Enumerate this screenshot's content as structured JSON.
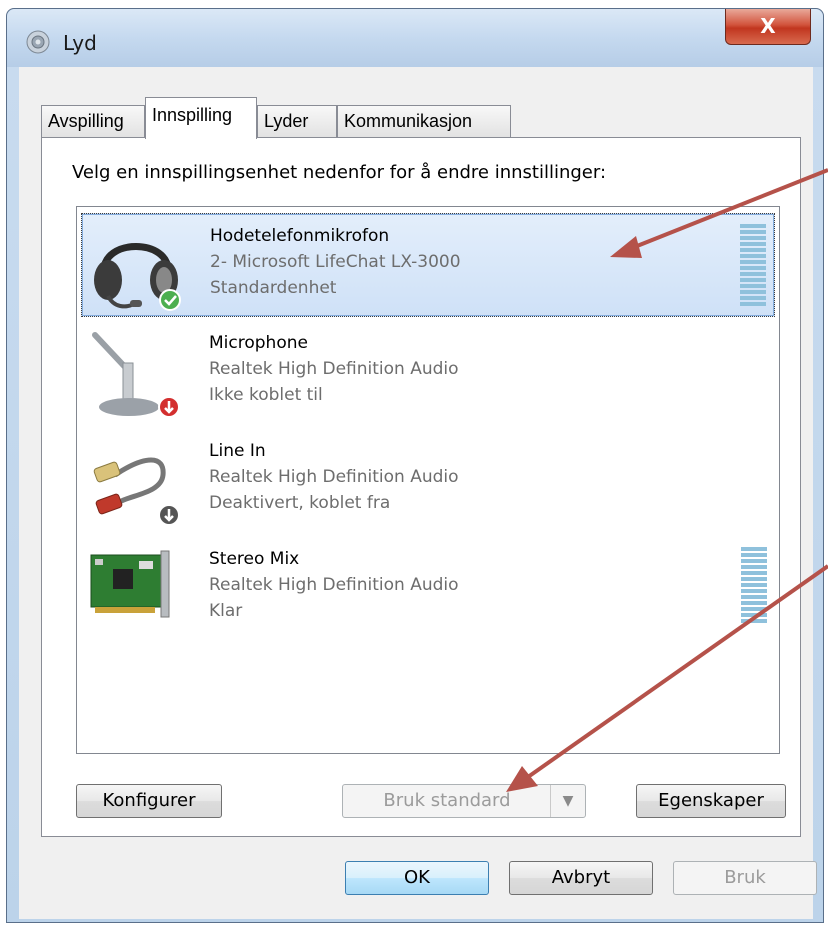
{
  "window": {
    "title": "Lyd",
    "close_label": "X"
  },
  "tabs": [
    {
      "label": "Avspilling",
      "active": false
    },
    {
      "label": "Innspilling",
      "active": true
    },
    {
      "label": "Lyder",
      "active": false
    },
    {
      "label": "Kommunikasjon",
      "active": false
    }
  ],
  "panel": {
    "instruction": "Velg en innspillingsenhet nedenfor for å endre innstillinger:"
  },
  "devices": [
    {
      "name": "Hodetelefonmikrofon",
      "driver": "2- Microsoft LifeChat LX-3000",
      "status": "Standardenhet",
      "icon": "headset-icon",
      "badge": "check-badge-icon",
      "selected": true
    },
    {
      "name": "Microphone",
      "driver": "Realtek High Definition Audio",
      "status": "Ikke koblet til",
      "icon": "microphone-icon",
      "badge": "red-down-badge-icon",
      "selected": false
    },
    {
      "name": "Line In",
      "driver": "Realtek High Definition Audio",
      "status": "Deaktivert, koblet fra",
      "icon": "rca-cable-icon",
      "badge": "gray-down-badge-icon",
      "selected": false
    },
    {
      "name": "Stereo Mix",
      "driver": "Realtek High Definition Audio",
      "status": "Klar",
      "icon": "sound-card-icon",
      "badge": "",
      "selected": false
    }
  ],
  "buttons": {
    "configure": "Konfigurer",
    "set_default": "Bruk standard",
    "properties": "Egenskaper",
    "ok": "OK",
    "cancel": "Avbryt",
    "apply": "Bruk"
  },
  "colors": {
    "selection": "#cfe1f7",
    "meter": "#8fc1dc",
    "annotation_arrow": "#b5524a",
    "close_button": "#c1361f"
  }
}
